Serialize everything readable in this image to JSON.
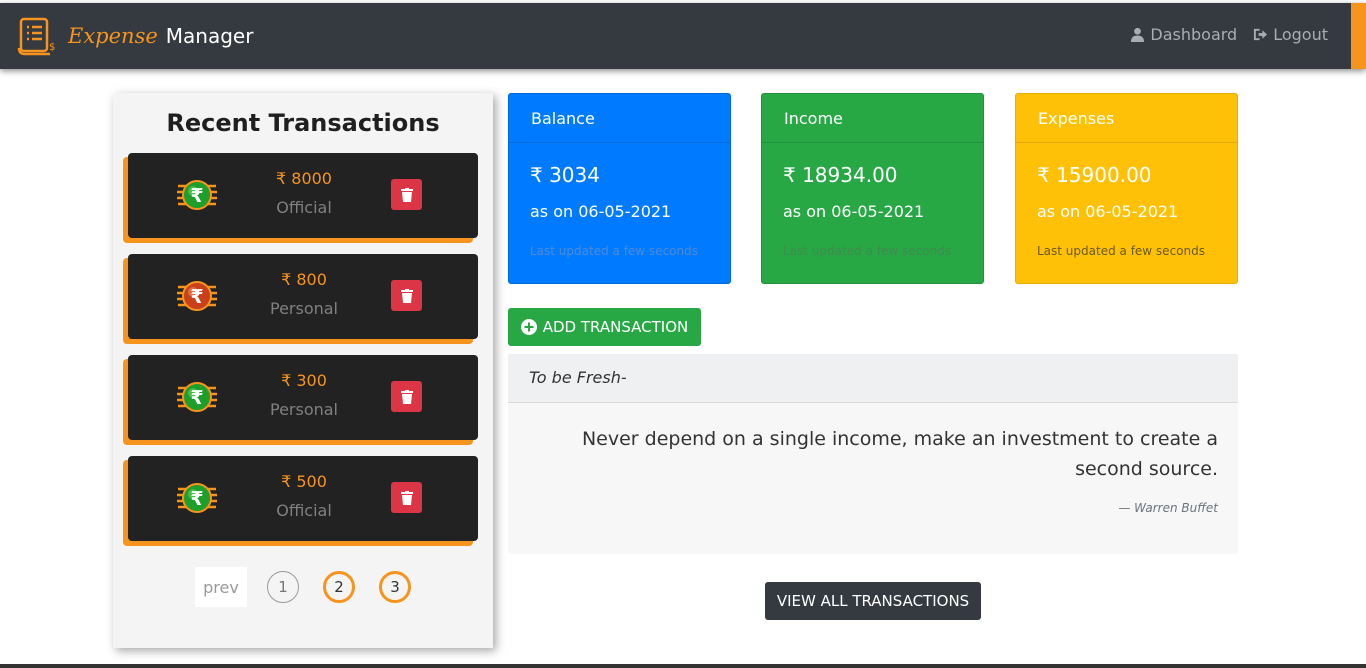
{
  "nav": {
    "brand_expense": "Expense",
    "brand_manager": "Manager",
    "dashboard": "Dashboard",
    "logout": "Logout",
    "accent": "#f7941d",
    "background": "#343a40"
  },
  "recent": {
    "title": "Recent Transactions",
    "items": [
      {
        "amount": "₹ 8000",
        "category": "Official",
        "coin": "green"
      },
      {
        "amount": "₹ 800",
        "category": "Personal",
        "coin": "red"
      },
      {
        "amount": "₹ 300",
        "category": "Personal",
        "coin": "green"
      },
      {
        "amount": "₹ 500",
        "category": "Official",
        "coin": "green"
      }
    ],
    "pagination": {
      "prev": "prev",
      "pages": [
        "1",
        "2",
        "3"
      ]
    }
  },
  "cards": {
    "balance": {
      "title": "Balance",
      "value": "₹ 3034",
      "date": "as on 06-05-2021",
      "updated": "Last updated a few seconds",
      "color": "#007bff"
    },
    "income": {
      "title": "Income",
      "value": "₹ 18934.00",
      "date": "as on 06-05-2021",
      "updated": "Last updated a few seconds",
      "color": "#28a745"
    },
    "expenses": {
      "title": "Expenses",
      "value": "₹ 15900.00",
      "date": "as on 06-05-2021",
      "updated": "Last updated a few seconds",
      "color": "#ffc107"
    }
  },
  "add_button": "ADD TRANSACTION",
  "quote": {
    "header": "To be Fresh-",
    "text": "Never depend on a single income, make an investment to create a second source.",
    "author": "— Warren Buffet"
  },
  "view_all_button": "VIEW ALL TRANSACTIONS"
}
